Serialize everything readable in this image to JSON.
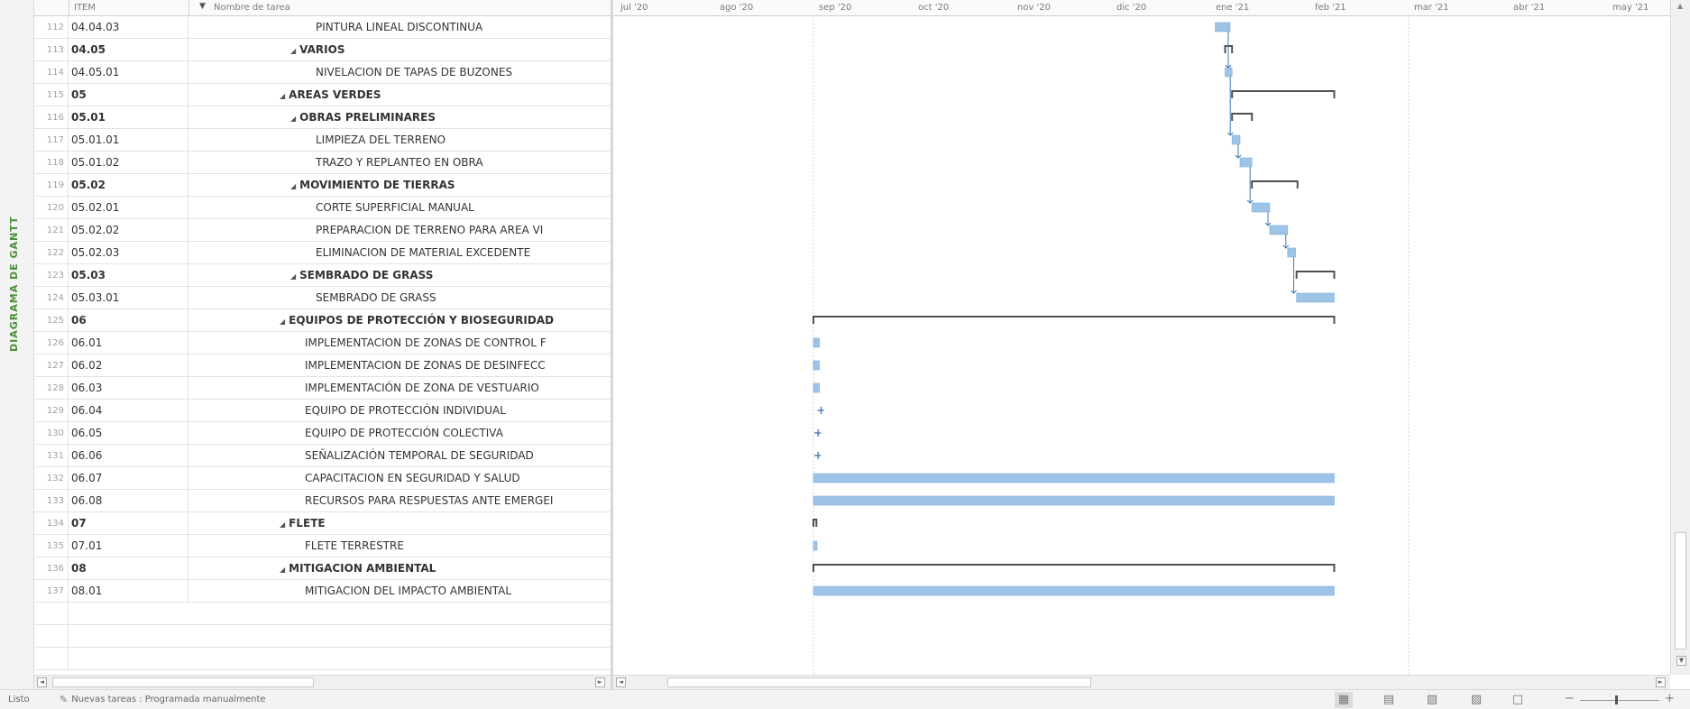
{
  "sidebar": {
    "view_label": "DIAGRAMA DE GANTT"
  },
  "grid": {
    "columns": {
      "item": "ITEM",
      "name": "Nombre de tarea"
    },
    "rows": [
      {
        "num": "112",
        "item": "04.04.03",
        "name": "PINTURA LINEAL DISCONTINUA",
        "level": 3,
        "summary": false
      },
      {
        "num": "113",
        "item": "04.05",
        "name": "VARIOS",
        "level": 2,
        "summary": true
      },
      {
        "num": "114",
        "item": "04.05.01",
        "name": "NIVELACION DE TAPAS DE BUZONES",
        "level": 3,
        "summary": false
      },
      {
        "num": "115",
        "item": "05",
        "name": "AREAS VERDES",
        "level": 1,
        "summary": true
      },
      {
        "num": "116",
        "item": "05.01",
        "name": "OBRAS PRELIMINARES",
        "level": 2,
        "summary": true
      },
      {
        "num": "117",
        "item": "05.01.01",
        "name": "LIMPIEZA DEL TERRENO",
        "level": 3,
        "summary": false
      },
      {
        "num": "118",
        "item": "05.01.02",
        "name": "TRAZO Y REPLANTEO EN OBRA",
        "level": 3,
        "summary": false
      },
      {
        "num": "119",
        "item": "05.02",
        "name": "MOVIMIENTO DE TIERRAS",
        "level": 2,
        "summary": true
      },
      {
        "num": "120",
        "item": "05.02.01",
        "name": "CORTE SUPERFICIAL MANUAL",
        "level": 3,
        "summary": false
      },
      {
        "num": "121",
        "item": "05.02.02",
        "name": "PREPARACION DE TERRENO PARA AREA VI",
        "level": 3,
        "summary": false
      },
      {
        "num": "122",
        "item": "05.02.03",
        "name": "ELIMINACION DE MATERIAL EXCEDENTE",
        "level": 3,
        "summary": false
      },
      {
        "num": "123",
        "item": "05.03",
        "name": "SEMBRADO DE GRASS",
        "level": 2,
        "summary": true
      },
      {
        "num": "124",
        "item": "05.03.01",
        "name": "SEMBRADO DE GRASS",
        "level": 3,
        "summary": false
      },
      {
        "num": "125",
        "item": "06",
        "name": "EQUIPOS DE PROTECCIÓN Y BIOSEGURIDAD",
        "level": 1,
        "summary": true
      },
      {
        "num": "126",
        "item": "06.01",
        "name": "IMPLEMENTACION DE ZONAS DE CONTROL F",
        "level": 2,
        "summary": false
      },
      {
        "num": "127",
        "item": "06.02",
        "name": "IMPLEMENTACION DE ZONAS DE DESINFECC",
        "level": 2,
        "summary": false
      },
      {
        "num": "128",
        "item": "06.03",
        "name": "IMPLEMENTACIÓN DE ZONA DE VESTUARIO",
        "level": 2,
        "summary": false
      },
      {
        "num": "129",
        "item": "06.04",
        "name": "EQUIPO DE PROTECCIÓN INDIVIDUAL",
        "level": 2,
        "summary": false
      },
      {
        "num": "130",
        "item": "06.05",
        "name": "EQUIPO DE PROTECCIÓN COLECTIVA",
        "level": 2,
        "summary": false
      },
      {
        "num": "131",
        "item": "06.06",
        "name": "SEÑALIZACIÓN TEMPORAL DE SEGURIDAD",
        "level": 2,
        "summary": false
      },
      {
        "num": "132",
        "item": "06.07",
        "name": "CAPACITACION EN SEGURIDAD Y SALUD",
        "level": 2,
        "summary": false
      },
      {
        "num": "133",
        "item": "06.08",
        "name": "RECURSOS PARA RESPUESTAS ANTE EMERGEI",
        "level": 2,
        "summary": false
      },
      {
        "num": "134",
        "item": "07",
        "name": "FLETE",
        "level": 1,
        "summary": true
      },
      {
        "num": "135",
        "item": "07.01",
        "name": "FLETE TERRESTRE",
        "level": 2,
        "summary": false
      },
      {
        "num": "136",
        "item": "08",
        "name": "MITIGACION AMBIENTAL",
        "level": 1,
        "summary": true
      },
      {
        "num": "137",
        "item": "08.01",
        "name": "MITIGACION DEL IMPACTO AMBIENTAL",
        "level": 2,
        "summary": false
      }
    ]
  },
  "timeline": {
    "months": [
      "jul '20",
      "ago '20",
      "sep '20",
      "oct '20",
      "nov '20",
      "dic '20",
      "ene '21",
      "feb '21",
      "mar '21",
      "abr '21",
      "may '21"
    ],
    "bar_color": "#9dc3e6",
    "summary_color": "#505050",
    "bars": [
      {
        "type": "task",
        "start": 6.05,
        "end": 6.2
      },
      {
        "type": "summary",
        "start": 6.15,
        "end": 6.22
      },
      {
        "type": "task",
        "start": 6.15,
        "end": 6.22
      },
      {
        "type": "summary",
        "start": 6.22,
        "end": 7.25
      },
      {
        "type": "summary",
        "start": 6.22,
        "end": 6.42
      },
      {
        "type": "task",
        "start": 6.22,
        "end": 6.3
      },
      {
        "type": "task",
        "start": 6.3,
        "end": 6.42
      },
      {
        "type": "summary",
        "start": 6.42,
        "end": 6.88
      },
      {
        "type": "task",
        "start": 6.42,
        "end": 6.6
      },
      {
        "type": "task",
        "start": 6.6,
        "end": 6.78
      },
      {
        "type": "task",
        "start": 6.78,
        "end": 6.86
      },
      {
        "type": "summary",
        "start": 6.87,
        "end": 7.25
      },
      {
        "type": "task",
        "start": 6.87,
        "end": 7.25
      },
      {
        "type": "summary",
        "start": 2.0,
        "end": 7.25
      },
      {
        "type": "task",
        "start": 2.0,
        "end": 2.06
      },
      {
        "type": "task",
        "start": 2.0,
        "end": 2.06
      },
      {
        "type": "task",
        "start": 2.0,
        "end": 2.06
      },
      {
        "type": "milestone",
        "start": 2.05,
        "end": 2.05
      },
      {
        "type": "milestone",
        "start": 2.02,
        "end": 2.02
      },
      {
        "type": "milestone",
        "start": 2.02,
        "end": 2.02
      },
      {
        "type": "task",
        "start": 2.0,
        "end": 7.25
      },
      {
        "type": "task",
        "start": 2.0,
        "end": 7.25
      },
      {
        "type": "summary",
        "start": 2.0,
        "end": 2.03
      },
      {
        "type": "task",
        "start": 2.0,
        "end": 2.03
      },
      {
        "type": "summary",
        "start": 2.0,
        "end": 7.25
      },
      {
        "type": "task",
        "start": 2.0,
        "end": 7.25
      }
    ]
  },
  "status": {
    "ready": "Listo",
    "new_tasks": "Nuevas tareas : Programada manualmente"
  }
}
